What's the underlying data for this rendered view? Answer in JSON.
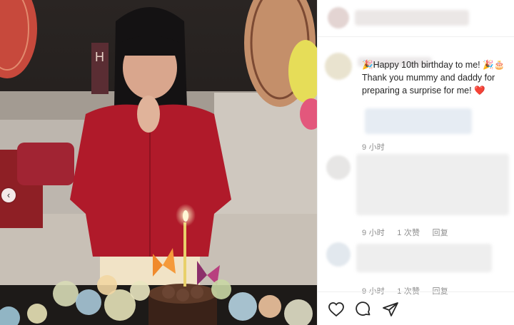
{
  "photo": {
    "banner_letter": "H"
  },
  "caption": {
    "line1": "🎉Happy 10th birthday to me! 🎉🎂Thank you mummy and daddy for preparing a surprise for me! ❤️"
  },
  "comments": [
    {
      "time": "9 小时"
    },
    {
      "time": "9 小时",
      "likes": "1 次赞",
      "reply": "回复"
    },
    {
      "time": "9 小时",
      "likes": "1 次赞",
      "reply": "回复"
    }
  ],
  "icons": [
    "heart-icon",
    "comment-icon",
    "share-icon",
    "chevron-left-icon"
  ],
  "colors": {
    "accent_red": "#b01a2a",
    "text": "#262626",
    "muted": "#8e8e8e"
  }
}
